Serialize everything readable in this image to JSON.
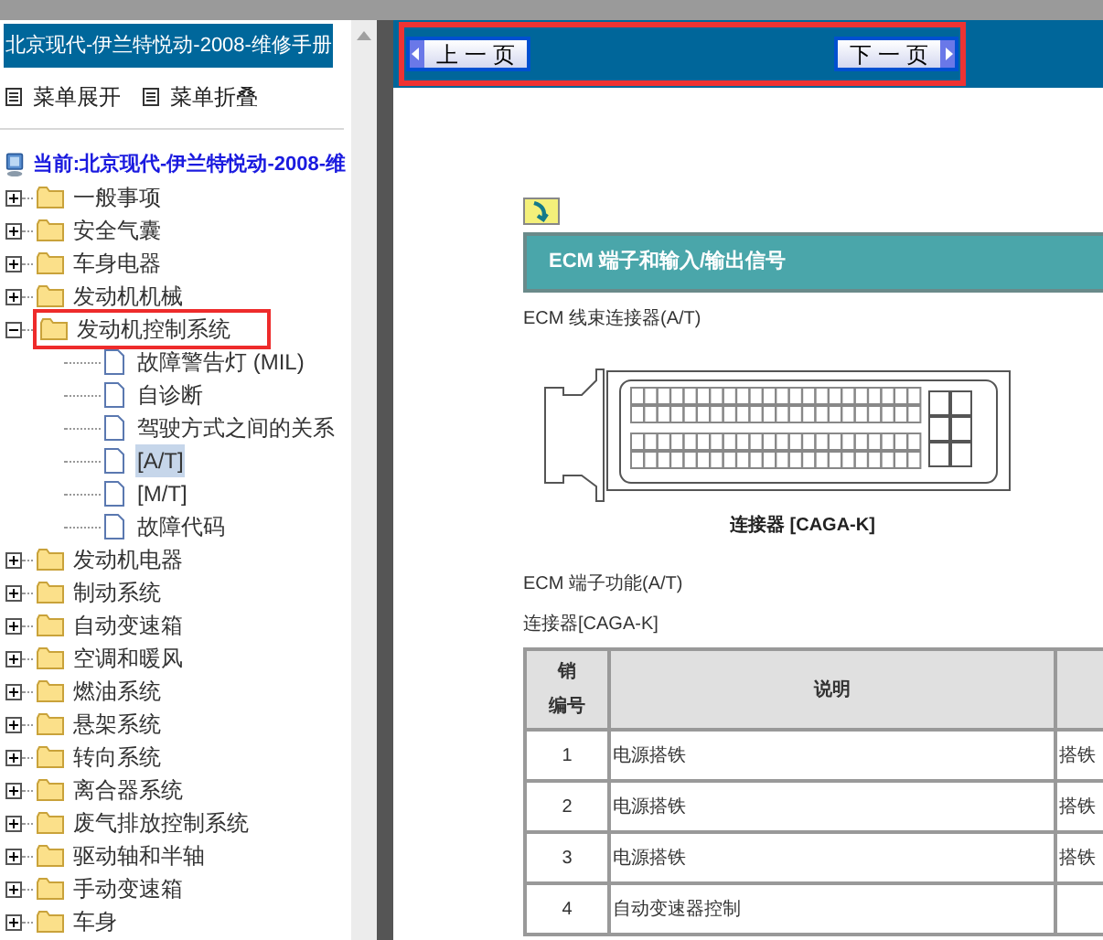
{
  "sidebar": {
    "title": "北京现代-伊兰特悦动-2008-维修手册",
    "menu_buttons": [
      "菜单展开",
      "菜单折叠"
    ],
    "tree": {
      "label": "当前:北京现代-伊兰特悦动-2008-维",
      "children": [
        {
          "label": "一般事项",
          "expanded": false,
          "highlighted": false
        },
        {
          "label": "安全气囊",
          "expanded": false,
          "highlighted": false
        },
        {
          "label": "车身电器",
          "expanded": false,
          "highlighted": false
        },
        {
          "label": "发动机机械",
          "expanded": false,
          "highlighted": false
        },
        {
          "label": "发动机控制系统",
          "expanded": true,
          "highlighted": true,
          "children": [
            {
              "label": "故障警告灯 (MIL)",
              "selected": false
            },
            {
              "label": "自诊断",
              "selected": false
            },
            {
              "label": "驾驶方式之间的关系",
              "selected": false
            },
            {
              "label": "[A/T]",
              "selected": true
            },
            {
              "label": "[M/T]",
              "selected": false
            },
            {
              "label": "故障代码",
              "selected": false
            }
          ]
        },
        {
          "label": "发动机电器",
          "expanded": false,
          "highlighted": false
        },
        {
          "label": "制动系统",
          "expanded": false,
          "highlighted": false
        },
        {
          "label": "自动变速箱",
          "expanded": false,
          "highlighted": false
        },
        {
          "label": "空调和暖风",
          "expanded": false,
          "highlighted": false
        },
        {
          "label": "燃油系统",
          "expanded": false,
          "highlighted": false
        },
        {
          "label": "悬架系统",
          "expanded": false,
          "highlighted": false
        },
        {
          "label": "转向系统",
          "expanded": false,
          "highlighted": false
        },
        {
          "label": "离合器系统",
          "expanded": false,
          "highlighted": false
        },
        {
          "label": "废气排放控制系统",
          "expanded": false,
          "highlighted": false
        },
        {
          "label": "驱动轴和半轴",
          "expanded": false,
          "highlighted": false
        },
        {
          "label": "手动变速箱",
          "expanded": false,
          "highlighted": false
        },
        {
          "label": "车身",
          "expanded": false,
          "highlighted": false
        }
      ]
    }
  },
  "nav": {
    "highlighted": true,
    "prev": "上 一 页",
    "next": "下 一 页"
  },
  "document": {
    "section_title": "ECM 端子和输入/输出信号",
    "connector_heading": "ECM 线束连接器(A/T)",
    "connector_caption": "连接器 [CAGA-K]",
    "function_heading": "ECM 端子功能(A/T)",
    "table_caption": "连接器[CAGA-K]",
    "table": {
      "header": {
        "pin_label_lines": [
          "销",
          "编号"
        ],
        "description": "说明"
      },
      "rows": [
        [
          "1",
          "电源搭铁",
          "搭铁"
        ],
        [
          "2",
          "电源搭铁",
          "搭铁"
        ],
        [
          "3",
          "电源搭铁",
          "搭铁"
        ],
        [
          "4",
          "自动变速器控制",
          ""
        ]
      ]
    }
  }
}
